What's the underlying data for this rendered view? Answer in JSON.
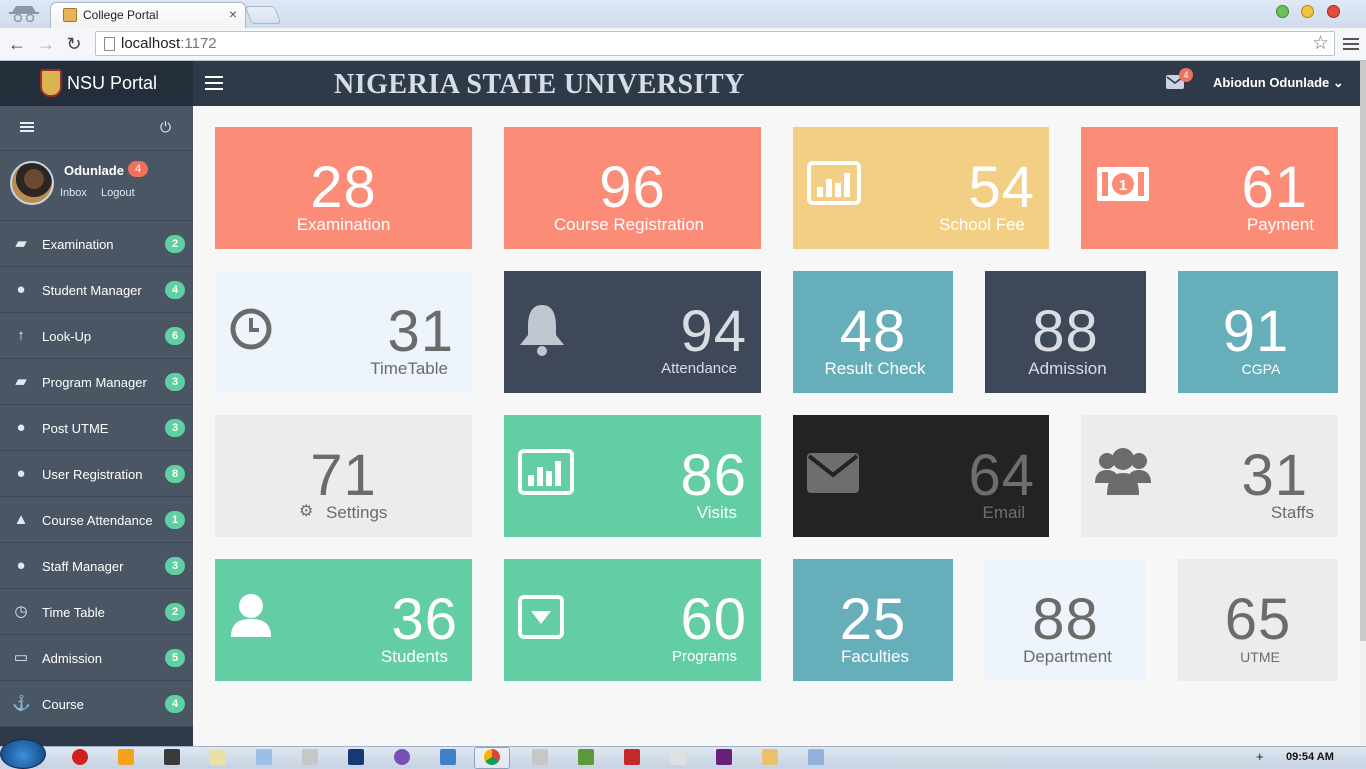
{
  "browser": {
    "tab_title": "College Portal",
    "tab_close": "×",
    "url_host": "localhost",
    "url_port": ":1172",
    "star_icon": "☆"
  },
  "header": {
    "brand": "NSU Portal",
    "university": "NIGERIA STATE UNIVERSITY",
    "mail_count": "4",
    "user": "Abiodun Odunlade"
  },
  "sidebar": {
    "profile": {
      "name": "Odunlade",
      "badge": "4",
      "inbox": "Inbox",
      "logout": "Logout"
    },
    "items": [
      {
        "label": "Examination",
        "badge": "2",
        "icon": "book-icon"
      },
      {
        "label": "Student Manager",
        "badge": "4",
        "icon": "users-icon"
      },
      {
        "label": "Look-Up",
        "badge": "6",
        "icon": "arrow-up-icon"
      },
      {
        "label": "Program Manager",
        "badge": "3",
        "icon": "book-icon"
      },
      {
        "label": "Post UTME",
        "badge": "3",
        "icon": "user-icon"
      },
      {
        "label": "User Registration",
        "badge": "8",
        "icon": "user-icon"
      },
      {
        "label": "Course Attendance",
        "badge": "1",
        "icon": "bell-icon"
      },
      {
        "label": "Staff Manager",
        "badge": "3",
        "icon": "user-icon"
      },
      {
        "label": "Time Table",
        "badge": "2",
        "icon": "clock-icon"
      },
      {
        "label": "Admission",
        "badge": "5",
        "icon": "laptop-icon"
      },
      {
        "label": "Course",
        "badge": "4",
        "icon": "anchor-icon"
      }
    ]
  },
  "tiles": [
    {
      "value": "28",
      "label": "Examination"
    },
    {
      "value": "96",
      "label": "Course Registration"
    },
    {
      "value": "54",
      "label": "School Fee"
    },
    {
      "value": "61",
      "label": "Payment"
    },
    {
      "value": "31",
      "label": "TimeTable"
    },
    {
      "value": "94",
      "label": "Attendance"
    },
    {
      "value": "48",
      "label": "Result Check"
    },
    {
      "value": "88",
      "label": "Admission"
    },
    {
      "value": "91",
      "label": "CGPA"
    },
    {
      "value": "71",
      "label": "Settings"
    },
    {
      "value": "86",
      "label": "Visits"
    },
    {
      "value": "64",
      "label": "Email"
    },
    {
      "value": "31",
      "label": "Staffs"
    },
    {
      "value": "36",
      "label": "Students"
    },
    {
      "value": "60",
      "label": "Programs"
    },
    {
      "value": "25",
      "label": "Faculties"
    },
    {
      "value": "88",
      "label": "Department"
    },
    {
      "value": "65",
      "label": "UTME"
    }
  ],
  "colors": {
    "salmon": "#fb8d78",
    "yellow": "#f2cf85",
    "navy": "#3e4859",
    "teal": "#67aebb",
    "green": "#63cea3",
    "black": "#232323",
    "grey": "#ececec",
    "light": "#eef4fb",
    "badge_green": "#5fd0a2"
  },
  "taskbar": {
    "clock": "09:54 AM"
  }
}
